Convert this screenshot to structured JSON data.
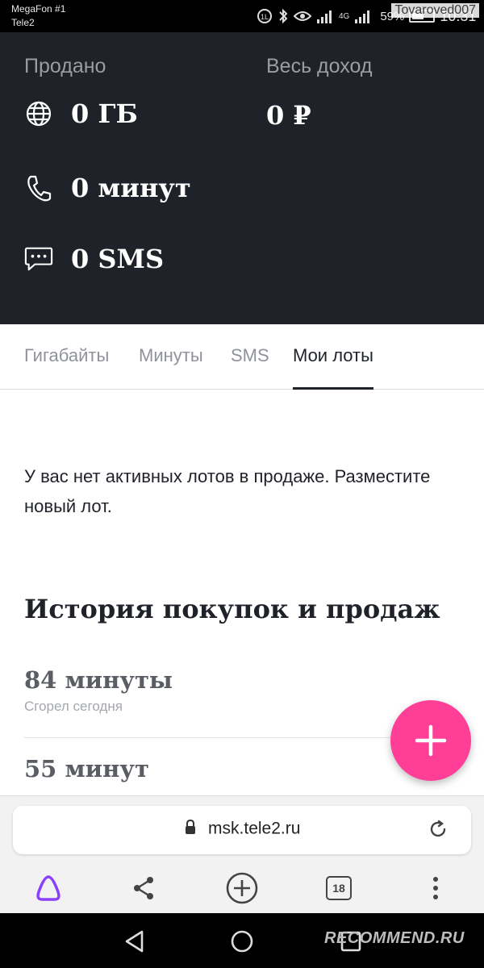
{
  "status_bar": {
    "carrier_1": "MegaFon #1",
    "carrier_2": "Tele2",
    "network": "4G",
    "battery": "59%",
    "time": "10:31"
  },
  "watermark_top": "Tovaroved007",
  "summary": {
    "sold_label": "Продано",
    "income_label": "Весь доход",
    "gb_value": "0 ГБ",
    "minutes_value": "0 минут",
    "sms_value": "0 SMS",
    "income_value": "0 ₽",
    "icons": [
      "globe-icon",
      "phone-icon",
      "chat-icon"
    ]
  },
  "tabs": [
    {
      "label": "Гигабайты",
      "active": false
    },
    {
      "label": "Минуты",
      "active": false
    },
    {
      "label": "SMS",
      "active": false
    },
    {
      "label": "Мои лоты",
      "active": true
    }
  ],
  "empty_message": "У вас нет активных лотов в продаже. Разместите новый лот.",
  "history": {
    "title": "История покупок и продаж",
    "items": [
      {
        "amount": "84 минуты",
        "status": "Сгорел сегодня"
      },
      {
        "amount": "55 минут",
        "status": ""
      }
    ]
  },
  "browser": {
    "url": "msk.tele2.ru",
    "tab_count": "18"
  },
  "watermark_bottom": "RECOMMEND.RU",
  "colors": {
    "header_bg": "#1f2229",
    "accent_fab": "#ff3e97",
    "alice": "#8a3ffc"
  }
}
